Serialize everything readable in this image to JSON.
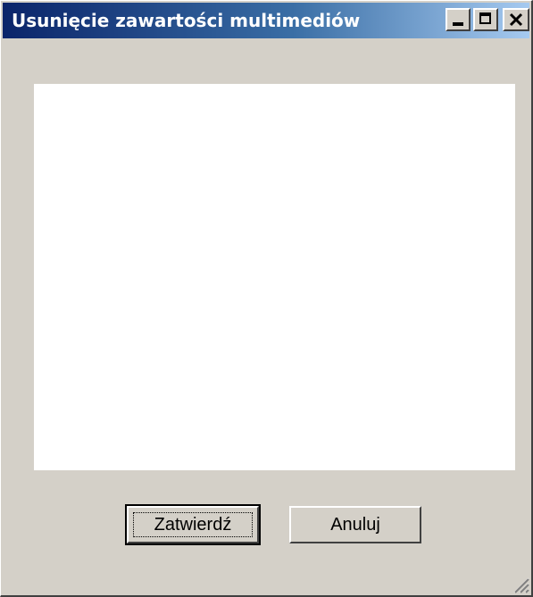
{
  "window": {
    "title": "Usunięcie zawartości multimediów",
    "controls": {
      "minimize_icon": "minimize-icon",
      "maximize_icon": "maximize-icon",
      "close_icon": "close-icon"
    }
  },
  "listbox": {
    "items": []
  },
  "buttons": {
    "confirm_label": "Zatwierdź",
    "cancel_label": "Anuluj"
  },
  "colors": {
    "face": "#d4d0c8",
    "title_start": "#0a246a",
    "title_end": "#a6caf0",
    "listbox_bg": "#ffffff"
  }
}
